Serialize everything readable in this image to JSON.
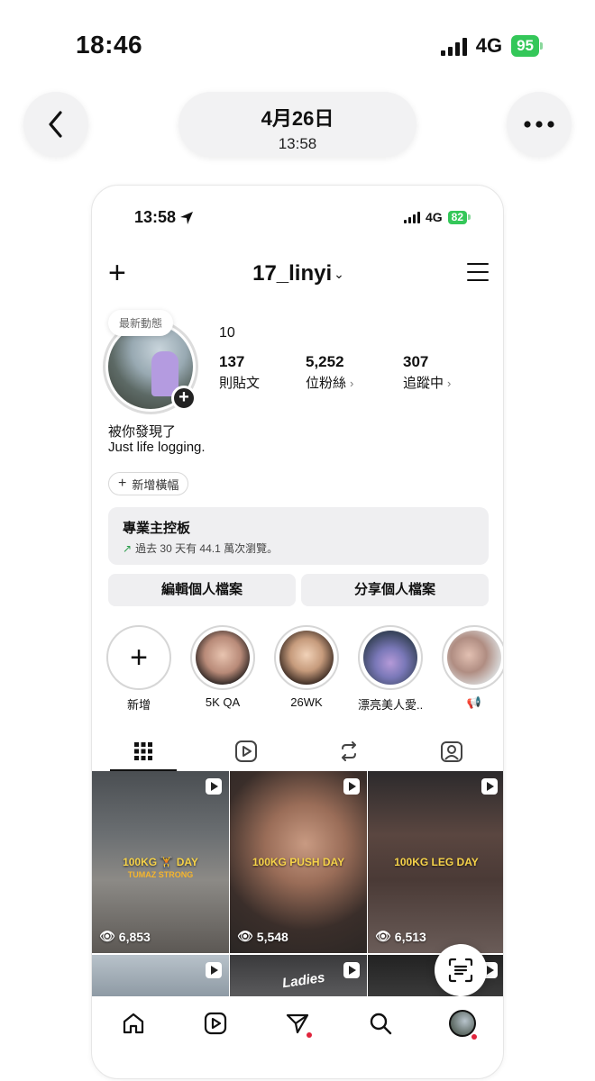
{
  "outer": {
    "time": "18:46",
    "network": "4G",
    "battery": "95",
    "date": "4月26日",
    "date_time": "13:58",
    "icons": {
      "back": "chevron-left-icon",
      "more": "more-horizontal-icon"
    }
  },
  "phone": {
    "time": "13:58",
    "network": "4G",
    "battery": "82"
  },
  "profile": {
    "username": "17_linyi",
    "note": "最新動態",
    "name": "10",
    "stats": [
      {
        "value": "137",
        "label": "則貼文",
        "arrow": ""
      },
      {
        "value": "5,252",
        "label": "位粉絲",
        "arrow": "›"
      },
      {
        "value": "307",
        "label": "追蹤中",
        "arrow": "›"
      }
    ],
    "bio_line1": "被你發現了",
    "bio_line2": "Just life logging.",
    "add_banner": "新增橫幅"
  },
  "dashboard": {
    "title": "專業主控板",
    "subtitle": "過去 30 天有 44.1 萬次瀏覽。"
  },
  "actions": {
    "edit": "編輯個人檔案",
    "share": "分享個人檔案"
  },
  "highlights": [
    {
      "label": "新增"
    },
    {
      "label": "5K QA"
    },
    {
      "label": "26WK"
    },
    {
      "label": "漂亮美人愛..."
    },
    {
      "label": "📢"
    }
  ],
  "posts": [
    {
      "caption": "100KG 🏋 DAY",
      "caption2": "TUMAZ STRONG",
      "views": "6,853"
    },
    {
      "caption": "100KG PUSH DAY",
      "caption2": "",
      "views": "5,548"
    },
    {
      "caption": "100KG LEG DAY",
      "caption2": "",
      "views": "6,513"
    }
  ],
  "second_row_text": "Ladies",
  "colors": {
    "accent_green": "#34c759",
    "notification_red": "#e0243c"
  }
}
